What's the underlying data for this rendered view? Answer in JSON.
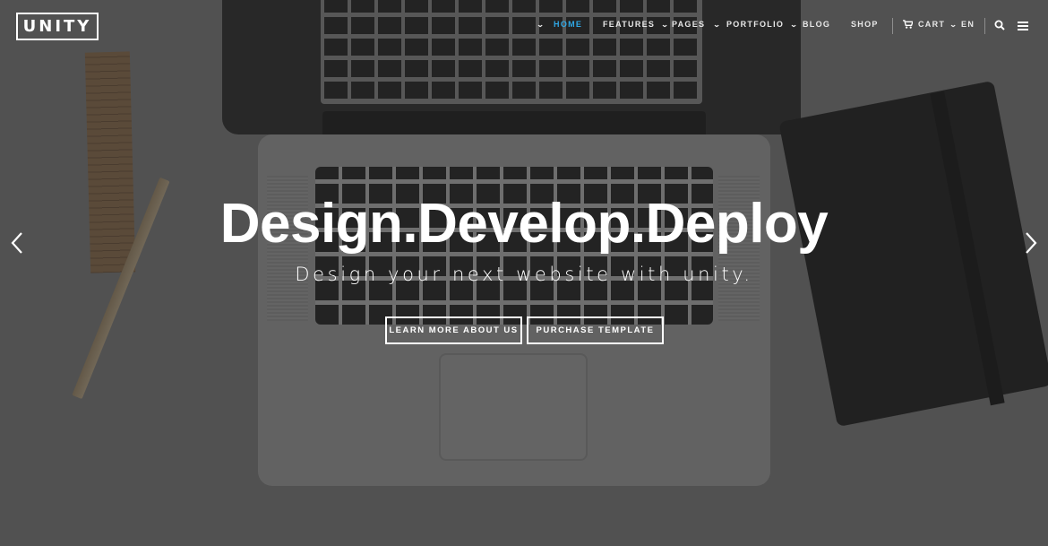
{
  "header": {
    "logo_text": "UNITY",
    "nav": {
      "home": "HOME",
      "features": "FEATURES",
      "pages": "PAGES",
      "portfolio": "PORTFOLIO",
      "blog": "BLOG",
      "shop": "SHOP",
      "cart": "CART",
      "language": "EN"
    },
    "active_item": "HOME",
    "accent_color": "#2fa8e6",
    "icons": [
      "chevron-down-icon",
      "cart-icon",
      "search-icon",
      "menu-icon"
    ]
  },
  "hero": {
    "title": "Design.Develop.Deploy",
    "subtitle": "Design your next website with unity.",
    "buttons": {
      "learn_more": "LEARN MORE ABOUT US",
      "purchase": "PURCHASE TEMPLATE"
    }
  },
  "slider": {
    "prev_icon": "chevron-left-icon",
    "next_icon": "chevron-right-icon"
  }
}
